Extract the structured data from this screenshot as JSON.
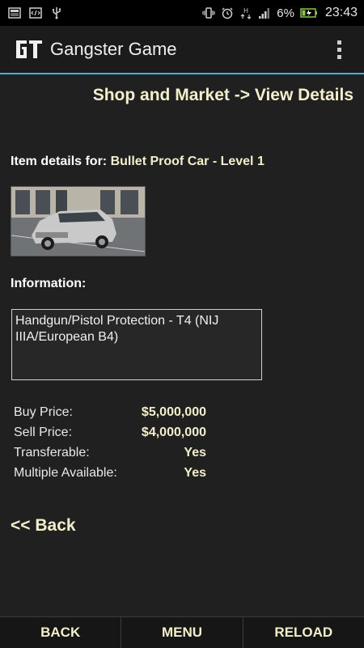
{
  "status_bar": {
    "battery_percent": "6%",
    "time": "23:43",
    "data_indicator": "H"
  },
  "action_bar": {
    "title": "Gangster Game"
  },
  "page": {
    "heading": "Shop and Market -> View Details",
    "item_prefix": "Item details for: ",
    "item_name": "Bullet Proof Car - Level 1",
    "information_label": "Information:",
    "information_text": "Handgun/Pistol Protection - T4 (NIJ IIIA/European B4)",
    "details": [
      {
        "label": "Buy Price:",
        "value": "$5,000,000"
      },
      {
        "label": "Sell Price:",
        "value": "$4,000,000"
      },
      {
        "label": "Transferable:",
        "value": "Yes"
      },
      {
        "label": "Multiple Available:",
        "value": "Yes"
      }
    ],
    "back_link": "<< Back"
  },
  "bottom_bar": {
    "buttons": [
      "BACK",
      "MENU",
      "RELOAD"
    ]
  },
  "colors": {
    "accent": "#33b5e5",
    "highlight_text": "#f3eecb",
    "background": "#202020"
  }
}
